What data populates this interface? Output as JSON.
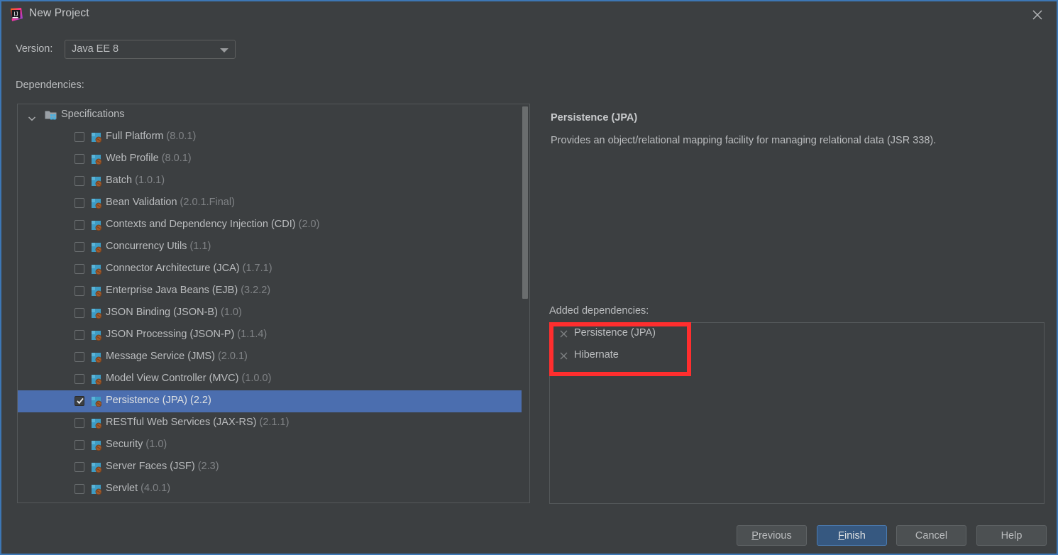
{
  "window": {
    "title": "New Project",
    "app_icon": "intellij-idea-icon",
    "close_icon": "close-icon",
    "accent_border": "#3d77b5"
  },
  "form": {
    "version_label": "Version:",
    "version_value": "Java EE 8",
    "version_options": [
      "Java EE 8"
    ],
    "dependencies_label": "Dependencies:"
  },
  "tree": {
    "group": {
      "label": "Specifications",
      "expanded": true,
      "chevron_icon": "chevron-down-icon",
      "folder_icon": "specifications-folder-icon"
    },
    "items": [
      {
        "label": "Full Platform",
        "version": "(8.0.1)",
        "checked": false,
        "selected": false
      },
      {
        "label": "Web Profile",
        "version": "(8.0.1)",
        "checked": false,
        "selected": false
      },
      {
        "label": "Batch",
        "version": "(1.0.1)",
        "checked": false,
        "selected": false
      },
      {
        "label": "Bean Validation",
        "version": "(2.0.1.Final)",
        "checked": false,
        "selected": false
      },
      {
        "label": "Contexts and Dependency Injection (CDI)",
        "version": "(2.0)",
        "checked": false,
        "selected": false
      },
      {
        "label": "Concurrency Utils",
        "version": "(1.1)",
        "checked": false,
        "selected": false
      },
      {
        "label": "Connector Architecture (JCA)",
        "version": "(1.7.1)",
        "checked": false,
        "selected": false
      },
      {
        "label": "Enterprise Java Beans (EJB)",
        "version": "(3.2.2)",
        "checked": false,
        "selected": false
      },
      {
        "label": "JSON Binding (JSON-B)",
        "version": "(1.0)",
        "checked": false,
        "selected": false
      },
      {
        "label": "JSON Processing (JSON-P)",
        "version": "(1.1.4)",
        "checked": false,
        "selected": false
      },
      {
        "label": "Message Service (JMS)",
        "version": "(2.0.1)",
        "checked": false,
        "selected": false
      },
      {
        "label": "Model View Controller (MVC)",
        "version": "(1.0.0)",
        "checked": false,
        "selected": false
      },
      {
        "label": "Persistence (JPA)",
        "version": "(2.2)",
        "checked": true,
        "selected": true
      },
      {
        "label": "RESTful Web Services (JAX-RS)",
        "version": "(2.1.1)",
        "checked": false,
        "selected": false
      },
      {
        "label": "Security",
        "version": "(1.0)",
        "checked": false,
        "selected": false
      },
      {
        "label": "Server Faces (JSF)",
        "version": "(2.3)",
        "checked": false,
        "selected": false
      },
      {
        "label": "Servlet",
        "version": "(4.0.1)",
        "checked": false,
        "selected": false
      }
    ]
  },
  "details": {
    "title": "Persistence (JPA)",
    "description": "Provides an object/relational mapping facility for managing relational data (JSR 338)."
  },
  "added": {
    "label": "Added dependencies:",
    "remove_icon": "remove-x-icon",
    "items": [
      {
        "label": "Persistence (JPA)"
      },
      {
        "label": "Hibernate"
      }
    ]
  },
  "annotation": {
    "color": "#ff2e2e",
    "target": "added-dependencies-items"
  },
  "buttons": {
    "previous": {
      "prefix": "P",
      "rest": "revious"
    },
    "finish": {
      "prefix": "F",
      "rest": "inish"
    },
    "cancel": "Cancel",
    "help": "Help"
  }
}
